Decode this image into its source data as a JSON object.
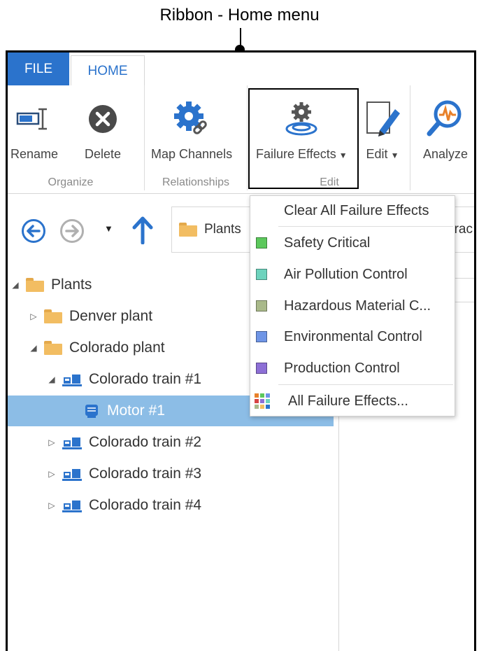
{
  "caption": "Ribbon - Home menu",
  "tabs": {
    "file": "FILE",
    "home": "HOME"
  },
  "ribbon": {
    "buttons": {
      "rename": "Rename",
      "delete": "Delete",
      "map_channels": "Map Channels",
      "failure_effects": "Failure Effects",
      "edit": "Edit",
      "analyze": "Analyze"
    },
    "groups": {
      "organize": "Organize",
      "relationships": "Relationships",
      "edit": "Edit"
    }
  },
  "nav": {
    "path": "Plants",
    "path2": "orac"
  },
  "tree": [
    {
      "label": "Plants",
      "expand": "◢"
    },
    {
      "label": "Denver plant",
      "expand": "▷"
    },
    {
      "label": "Colorado plant",
      "expand": "◢"
    },
    {
      "label": "Colorado train #1",
      "expand": "◢"
    },
    {
      "label": "Motor #1",
      "expand": ""
    },
    {
      "label": "Colorado train #2",
      "expand": "▷"
    },
    {
      "label": "Colorado train #3",
      "expand": "▷"
    },
    {
      "label": "Colorado train #4",
      "expand": "▷"
    }
  ],
  "dropdown": {
    "clear": "Clear All Failure Effects",
    "items": [
      {
        "label": "Safety Critical",
        "color": "#5cc85c"
      },
      {
        "label": "Air Pollution Control",
        "color": "#6dd3bd"
      },
      {
        "label": "Hazardous Material C...",
        "color": "#a9b98a"
      },
      {
        "label": "Environmental Control",
        "color": "#6f95e6"
      },
      {
        "label": "Production Control",
        "color": "#8d6fd6"
      }
    ],
    "all": "All Failure Effects..."
  },
  "colors": {
    "accent": "#2b73cc",
    "selection": "#8cbde6",
    "folder": "#f2bd62"
  }
}
